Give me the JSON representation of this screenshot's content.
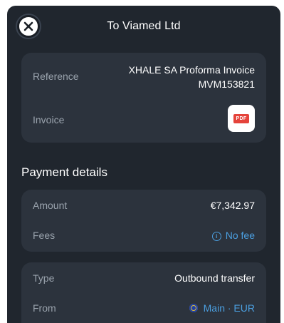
{
  "header": {
    "title": "To Viamed Ltd",
    "close_icon": "close-icon"
  },
  "reference_card": {
    "reference_label": "Reference",
    "reference_value": "XHALE SA Proforma Invoice MVM153821",
    "invoice_label": "Invoice",
    "invoice_file_badge": "PDF",
    "invoice_icon": "pdf-file-icon"
  },
  "payment_details": {
    "section_title": "Payment details",
    "amount_label": "Amount",
    "amount_value": "€7,342.97",
    "fees_label": "Fees",
    "fees_value": "No fee",
    "fees_icon": "info-icon"
  },
  "transfer_card": {
    "type_label": "Type",
    "type_value": "Outbound transfer",
    "from_label": "From",
    "from_value": "Main · EUR",
    "from_icon": "eu-flag-icon"
  },
  "colors": {
    "background": "#20262e",
    "card": "#2c333d",
    "label": "#9aa3ad",
    "accent": "#4b9fe0",
    "pdf_red": "#e5433b"
  }
}
